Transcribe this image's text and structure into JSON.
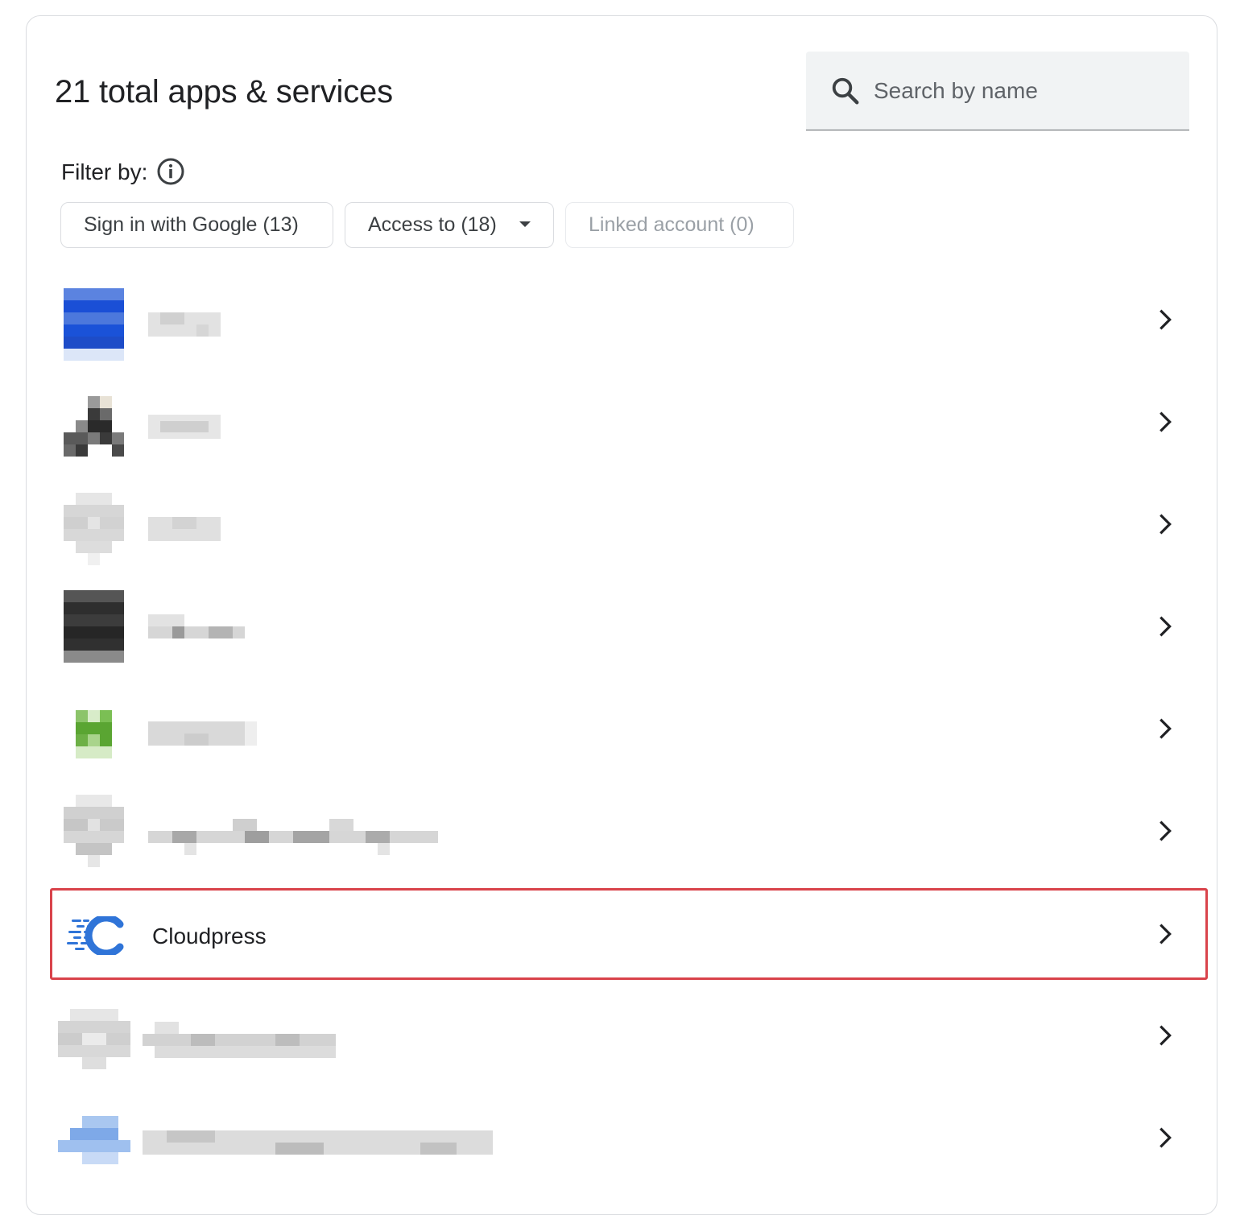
{
  "header": {
    "title": "21 total apps & services"
  },
  "search": {
    "placeholder": "Search by name"
  },
  "filters": {
    "label": "Filter by:",
    "chips": [
      {
        "label": "Sign in with Google (13)",
        "enabled": true
      },
      {
        "label": "Access to (18)",
        "enabled": true,
        "has_dropdown": true
      },
      {
        "label": "Linked account (0)",
        "enabled": false
      }
    ]
  },
  "apps": [
    {
      "name": "",
      "obscured": true,
      "icon_color": "#1a56db"
    },
    {
      "name": "",
      "obscured": true,
      "icon_color": "#444444"
    },
    {
      "name": "",
      "obscured": true,
      "icon_color": "#d5d5d5"
    },
    {
      "name": "",
      "obscured": true,
      "icon_color": "#333333"
    },
    {
      "name": "",
      "obscured": true,
      "icon_color": "#5aa532"
    },
    {
      "name": "",
      "obscured": true,
      "icon_color": "#cccccc"
    },
    {
      "name": "Cloudpress",
      "obscured": false,
      "highlighted": true,
      "icon_color": "#2f74d8"
    },
    {
      "name": "",
      "obscured": true,
      "icon_color": "#d8d8d8"
    },
    {
      "name": "",
      "obscured": true,
      "icon_color": "#a9c7f0"
    }
  ],
  "colors": {
    "highlight_border": "#d9434b",
    "chip_border": "#dadce0",
    "search_bg": "#f1f3f4"
  }
}
